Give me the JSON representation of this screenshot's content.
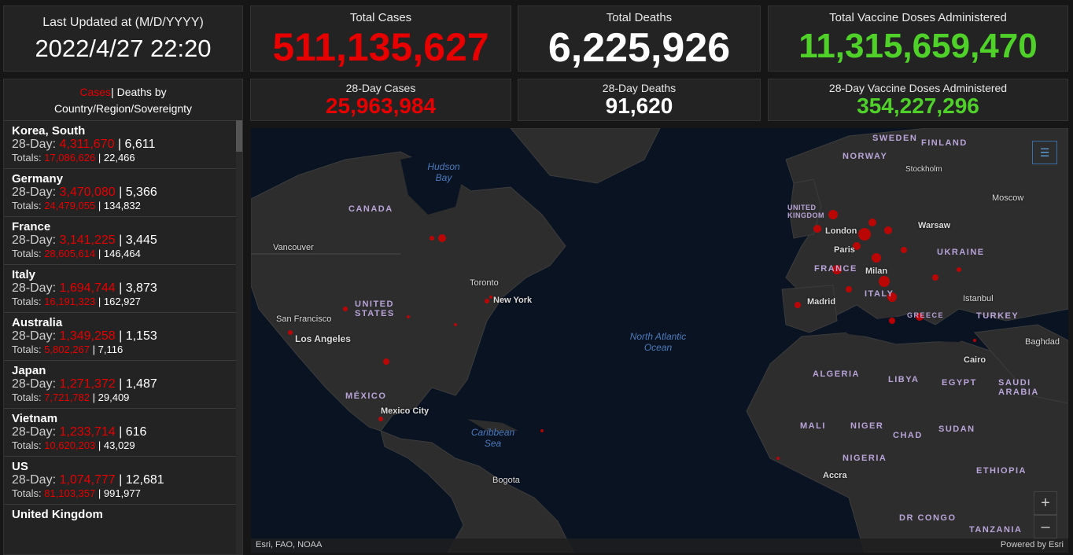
{
  "last_updated": {
    "label": "Last Updated at (M/D/YYYY)",
    "value": "2022/4/27 22:20"
  },
  "totals": {
    "cases_label": "Total Cases",
    "cases": "511,135,627",
    "deaths_label": "Total Deaths",
    "deaths": "6,225,926",
    "vaccine_label": "Total Vaccine Doses Administered",
    "vaccine": "11,315,659,470"
  },
  "day28": {
    "cases_label": "28-Day Cases",
    "cases": "25,963,984",
    "deaths_label": "28-Day Deaths",
    "deaths": "91,620",
    "vaccine_label": "28-Day Vaccine Doses Administered",
    "vaccine": "354,227,296"
  },
  "list": {
    "header_cases": "Cases",
    "header_rest": " Deaths by",
    "header_line2": "Country/Region/Sovereignty",
    "row1_label": "28-Day: ",
    "row2_label": "Totals: ",
    "items": [
      {
        "name": "Korea, South",
        "d28_cases": "4,311,670",
        "d28_deaths": "6,611",
        "tot_cases": "17,086,626",
        "tot_deaths": "22,466"
      },
      {
        "name": "Germany",
        "d28_cases": "3,470,080",
        "d28_deaths": "5,366",
        "tot_cases": "24,479,055",
        "tot_deaths": "134,832"
      },
      {
        "name": "France",
        "d28_cases": "3,141,225",
        "d28_deaths": "3,445",
        "tot_cases": "28,605,614",
        "tot_deaths": "146,464"
      },
      {
        "name": "Italy",
        "d28_cases": "1,694,744",
        "d28_deaths": "3,873",
        "tot_cases": "16,191,323",
        "tot_deaths": "162,927"
      },
      {
        "name": "Australia",
        "d28_cases": "1,349,258",
        "d28_deaths": "1,153",
        "tot_cases": "5,802,267",
        "tot_deaths": "7,116"
      },
      {
        "name": "Japan",
        "d28_cases": "1,271,372",
        "d28_deaths": "1,487",
        "tot_cases": "7,721,782",
        "tot_deaths": "29,409"
      },
      {
        "name": "Vietnam",
        "d28_cases": "1,233,714",
        "d28_deaths": "616",
        "tot_cases": "10,620,203",
        "tot_deaths": "43,029"
      },
      {
        "name": "US",
        "d28_cases": "1,074,777",
        "d28_deaths": "12,681",
        "tot_cases": "81,103,357",
        "tot_deaths": "991,977"
      },
      {
        "name": "United Kingdom",
        "d28_cases": "",
        "d28_deaths": "",
        "tot_cases": "",
        "tot_deaths": ""
      }
    ]
  },
  "map": {
    "countries": [
      "CANADA",
      "UNITED STATES",
      "MÉXICO",
      "ALGERIA",
      "LIBYA",
      "EGYPT",
      "SAUDI ARABIA",
      "MALI",
      "NIGER",
      "CHAD",
      "SUDAN",
      "NIGERIA",
      "ETHIOPIA",
      "DR CONGO",
      "TANZANIA",
      "SWEDEN",
      "FINLAND",
      "NORWAY",
      "UNITED KINGDOM",
      "FRANCE",
      "ITALY",
      "GREECE",
      "TURKEY",
      "UKRAINE"
    ],
    "cities": [
      "Vancouver",
      "San Francisco",
      "Los Angeles",
      "Toronto",
      "New York",
      "Mexico City",
      "Bogota",
      "London",
      "Paris",
      "Milan",
      "Madrid",
      "Warsaw",
      "Stockholm",
      "Moscow",
      "Istanbul",
      "Baghdad",
      "Cairo",
      "Accra"
    ],
    "oceans": [
      "Hudson Bay",
      "North Atlantic Ocean",
      "Caribbean Sea"
    ],
    "attribution_left": "Esri, FAO, NOAA",
    "attribution_right": "Powered by Esri",
    "zoom_in": "+",
    "zoom_out": "–"
  },
  "colors": {
    "red": "#e60000",
    "green": "#4fd12a",
    "panel": "#232323"
  }
}
